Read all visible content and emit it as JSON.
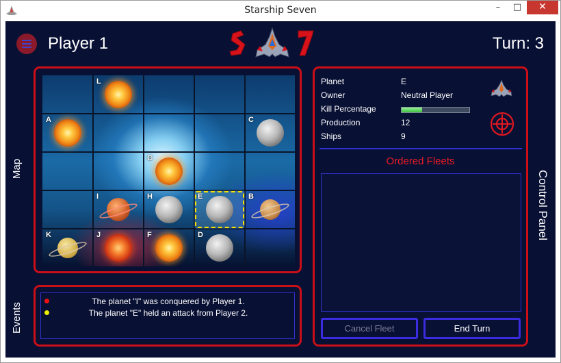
{
  "window": {
    "title": "Starship Seven",
    "minimize": "–",
    "maximize": "□",
    "close": "✕"
  },
  "header": {
    "player": "Player 1",
    "turn": "Turn: 3",
    "menu_icon": "hamburger-menu-icon"
  },
  "labels": {
    "map": "Map",
    "events": "Events",
    "control_panel": "Control Panel"
  },
  "map": {
    "cells": [
      {
        "label": "",
        "type": "empty"
      },
      {
        "label": "L",
        "type": "sun"
      },
      {
        "label": "",
        "type": "empty"
      },
      {
        "label": "",
        "type": "empty"
      },
      {
        "label": "",
        "type": "empty"
      },
      {
        "label": "A",
        "type": "sun"
      },
      {
        "label": "",
        "type": "empty"
      },
      {
        "label": "",
        "type": "empty"
      },
      {
        "label": "",
        "type": "empty"
      },
      {
        "label": "C",
        "type": "moon"
      },
      {
        "label": "",
        "type": "empty"
      },
      {
        "label": "",
        "type": "empty"
      },
      {
        "label": "G",
        "type": "sun"
      },
      {
        "label": "",
        "type": "empty"
      },
      {
        "label": "",
        "type": "empty"
      },
      {
        "label": "",
        "type": "empty"
      },
      {
        "label": "I",
        "type": "mars"
      },
      {
        "label": "H",
        "type": "moon"
      },
      {
        "label": "E",
        "type": "moon",
        "selected": true
      },
      {
        "label": "B",
        "type": "saturn-blue"
      },
      {
        "label": "K",
        "type": "saturn"
      },
      {
        "label": "J",
        "type": "sun-red"
      },
      {
        "label": "F",
        "type": "sun"
      },
      {
        "label": "D",
        "type": "moon"
      },
      {
        "label": "",
        "type": "empty"
      }
    ]
  },
  "events": [
    {
      "text": "The planet \"I\" was conquered by Player 1.",
      "color": "#ee1111"
    },
    {
      "text": "The planet \"E\" held an attack from Player 2.",
      "color": "#eeee00"
    }
  ],
  "planet_info": {
    "planet_label": "Planet",
    "planet_value": "E",
    "owner_label": "Owner",
    "owner_value": "Neutral Player",
    "kill_label": "Kill Percentage",
    "kill_fraction": 0.3,
    "production_label": "Production",
    "production_value": "12",
    "ships_label": "Ships",
    "ships_value": "9"
  },
  "control_panel": {
    "ordered_fleets_title": "Ordered Fleets",
    "cancel_fleet": "Cancel Fleet",
    "end_turn": "End Turn"
  },
  "colors": {
    "panel_border": "#cc0f17",
    "accent_blue": "#3a2ce0",
    "background": "#081034",
    "title_red": "#ee1c24"
  }
}
